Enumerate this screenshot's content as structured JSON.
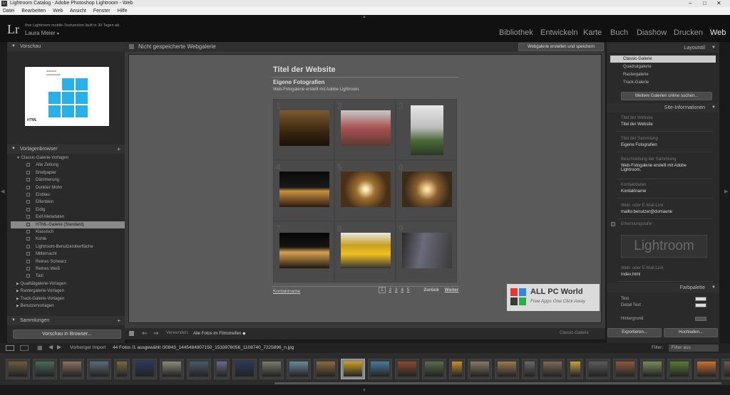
{
  "window": {
    "title": "Lightroom Catalog - Adobe Photoshop Lightroom - Web"
  },
  "menu": [
    "Datei",
    "Bearbeiten",
    "Web",
    "Ansicht",
    "Fenster",
    "Hilfe"
  ],
  "identity": {
    "logo": "Lr",
    "trial_note": "Ihre Lightroom mobile-Testversion läuft in 30 Tagen ab.",
    "user": "Laura Meier"
  },
  "modules": [
    "Bibliothek",
    "Entwickeln",
    "Karte",
    "Buch",
    "Diashow",
    "Drucken",
    "Web"
  ],
  "left": {
    "preview_header": "Vorschau",
    "preview_badge": "HTML",
    "templates_header": "Vorlagenbrowser",
    "folders": {
      "classic": "Classic-Galerie-Vorlagen",
      "quality": "Qualitätgalerie-Vorlagen",
      "grid": "Rastergalerie-Vorlagen",
      "track": "Track-Galerie-Vorlagen",
      "user": "Benutzervorlagen"
    },
    "templates": [
      "Alte Zeitung",
      "Briefpapier",
      "Dämmerung",
      "Dunkler Mohn",
      "Eisblau",
      "Elfenbein",
      "Eidig",
      "Exif-Metadaten",
      "HTML-Galerie (Standard)",
      "Klassisch",
      "Kohle",
      "Lightroom-Benutzeroberfläche",
      "Mitternacht",
      "Reines Schwarz",
      "Reines Weiß",
      "Taxi"
    ],
    "collections_header": "Sammlungen",
    "preview_button": "Vorschau in Browser..."
  },
  "center": {
    "title": "Nicht gespeicherte Webgalerie",
    "save_button": "Webgalerie erstellen und speichern",
    "site_title": "Titel der Website",
    "collection_title": "Eigene Fotografien",
    "collection_desc": "Web-Fotogalerie erstellt mit Adobe Lightroom.",
    "contact": "Kontaktname",
    "pages": [
      "1",
      "2",
      "3",
      "4",
      "5"
    ],
    "back": "Zurück",
    "next": "Weiter",
    "toolbar": {
      "use_label": "Verwenden:",
      "use_value": "Alle Fotos im Filmstreifen",
      "layout": "Classic-Galerie"
    }
  },
  "right": {
    "layout_header": "Layoutstil",
    "layouts": [
      "Classic-Galerie",
      "Quadratgalerie",
      "Rastergalerie",
      "Track-Galerie"
    ],
    "more_button": "Weitere Galerien online suchen...",
    "site_info_header": "Site-Informationen",
    "fields": [
      {
        "label": "Titel der Website",
        "value": "Titel der Website"
      },
      {
        "label": "Titel der Sammlung",
        "value": "Eigene Fotografien"
      },
      {
        "label": "Beschreibung der Sammlung",
        "value": "Web-Fotogalerie erstellt mit Adobe Lightroom."
      },
      {
        "label": "Kontaktdaten",
        "value": "Kontaktname"
      },
      {
        "label": "Web- oder E-Mail-Link",
        "value": "mailto:benutzer@domaene"
      }
    ],
    "identity_plate_label": "Erkennungstafel",
    "identity_plate_text": "Lightroom",
    "link_label": "Web- oder E-Mail-Link",
    "link_value": "index.html",
    "colors_header": "Farbpalette",
    "color_text": "Text",
    "color_detail": "Detail Text",
    "color_bg": "Hintergrund",
    "export_button": "Exportieren...",
    "upload_button": "Hochladen..."
  },
  "watermark": {
    "title": "ALL PC World",
    "sub": "Free Apps One Click Away"
  },
  "filmbar": {
    "source": "Vorheriger Import",
    "info": "44 Fotos /1 ausgewählt /30843_1445484907150_1533978056_1108740_7225896_n.jpg",
    "filter_label": "Filter:",
    "filter_value": "Filter aus"
  }
}
